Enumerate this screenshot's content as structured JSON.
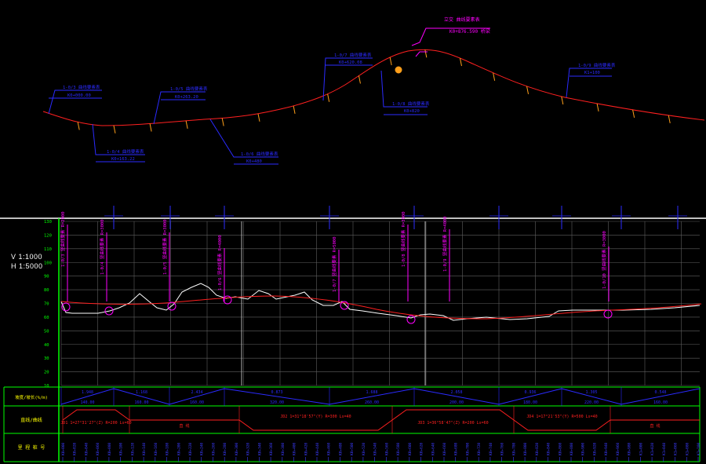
{
  "scales": {
    "vertical": "V 1:1000",
    "horizontal": "H 1:5000"
  },
  "elevation_axis": {
    "min": 10,
    "max": 100,
    "step": 10,
    "tick_labels": [
      "10",
      "20",
      "30",
      "40",
      "50",
      "60",
      "70",
      "80",
      "90",
      "100",
      "110",
      "120",
      "130"
    ]
  },
  "row_labels": {
    "grade": "坡度/坡长(%/m)",
    "alignment": "直线/曲线",
    "stations": "里 程 桩 号"
  },
  "plan_callouts": [
    {
      "title": "1-0/3 曲线要素表",
      "value": "K0+000.00"
    },
    {
      "title": "1-0/4 曲线要素表",
      "value": "K0+163.22"
    },
    {
      "title": "1-0/5 曲线要素表",
      "value": "K0+263.20"
    },
    {
      "title": "1-0/6 曲线要素表",
      "value": "K0+480"
    },
    {
      "title": "1-0/7 曲线要素表",
      "value": "K0+620.08"
    },
    {
      "title": "1-0/8 曲线要素表",
      "value": "K0+820"
    },
    {
      "title": "1-0/9 曲线要素表",
      "value": "K1+100"
    },
    {
      "title": "1-0/10 曲线要素表",
      "value": "K1+220"
    },
    {
      "title": "1-0/11 曲线要素表",
      "value": "K1+420"
    },
    {
      "title": "立交 曲线要素表",
      "value": "K0+876.590 桥梁"
    }
  ],
  "profile_callouts": [
    {
      "text": "1-0/3 竖曲线要素 R=2000"
    },
    {
      "text": "1-0/4 竖曲线要素 R=3000"
    },
    {
      "text": "1-0/5 竖曲线要素 R=3000"
    },
    {
      "text": "1-0/6 竖曲线要素 R=4000"
    },
    {
      "text": "1-0/7 竖曲线要素 R=5000"
    },
    {
      "text": "1-0/8 竖曲线要素 R=3000"
    },
    {
      "text": "1-0/9 竖曲线要素 R=4000"
    },
    {
      "text": "1-0/10 竖曲线要素 R=3000"
    }
  ],
  "grade_segments": [
    {
      "grade": "1.948",
      "length": "140.00"
    },
    {
      "grade": "1.168",
      "length": "160.00"
    },
    {
      "grade": "2.434",
      "length": "160.00"
    },
    {
      "grade": "0.873",
      "length": "320.00"
    },
    {
      "grade": "1.688",
      "length": "260.00"
    },
    {
      "grade": "2.058",
      "length": "200.00"
    },
    {
      "grade": "0.936",
      "length": "180.00"
    },
    {
      "grade": "1.305",
      "length": "220.00"
    },
    {
      "grade": "0.548",
      "length": "160.00"
    }
  ],
  "alignment_segments": [
    {
      "text": "JD1 1=27°31'27\"(Z) R=200 Ls=60"
    },
    {
      "text": "直 线"
    },
    {
      "text": "JD2 1=31°18'57\"(Y) R=300 Ls=40"
    },
    {
      "text": "JD3 1=36°58'47\"(Z) R=200 Ls=60"
    },
    {
      "text": "JD4 1=17°21'53\"(Y) R=500 Ls=40"
    },
    {
      "text": "直 线"
    }
  ],
  "station_labels": [
    "K0+000",
    "K0+020",
    "K0+040",
    "K0+060",
    "K0+080",
    "K0+100",
    "K0+120",
    "K0+140",
    "K0+160",
    "K0+180",
    "K0+200",
    "K0+220",
    "K0+240",
    "K0+260",
    "K0+280",
    "K0+300",
    "K0+320",
    "K0+340",
    "K0+360",
    "K0+380",
    "K0+400",
    "K0+420",
    "K0+440",
    "K0+460",
    "K0+480",
    "K0+500",
    "K0+520",
    "K0+540",
    "K0+560",
    "K0+580",
    "K0+600",
    "K0+620",
    "K0+640",
    "K0+660",
    "K0+680",
    "K0+700",
    "K0+720",
    "K0+740",
    "K0+760",
    "K0+780",
    "K0+800",
    "K0+820",
    "K0+840",
    "K0+860",
    "K0+880",
    "K0+900",
    "K0+920",
    "K0+940",
    "K0+960",
    "K0+980",
    "K1+000",
    "K1+020",
    "K1+040",
    "K1+060",
    "K1+080",
    "K1+100"
  ],
  "colors": {
    "background": "#000000",
    "grid": "#808080",
    "axis": "#00ff00",
    "design_line": "#ff2020",
    "ground_line": "#ffffff",
    "callout": "#2b2bff",
    "profile_callout": "#ff00ff",
    "station_text": "#3c3cff",
    "chainage_mark": "#ff9f1a"
  }
}
